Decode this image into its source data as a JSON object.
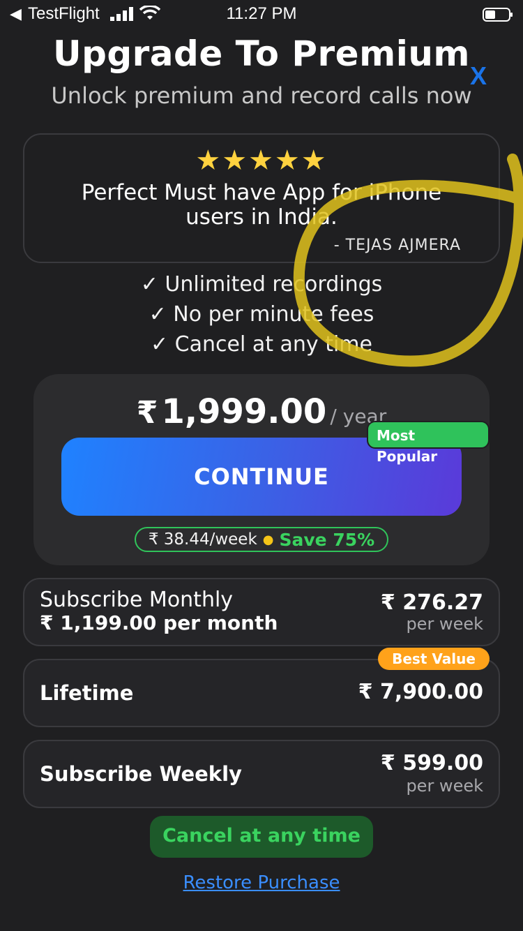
{
  "status_bar": {
    "back_arrow": "◀",
    "carrier": "TestFlight",
    "time": "11:27 PM",
    "icons": [
      "signal-bars-icon",
      "wifi-icon",
      "battery-icon"
    ]
  },
  "header": {
    "title": "Upgrade To Premium",
    "close_label": "X",
    "subtitle": "Unlock premium and record calls now"
  },
  "review": {
    "stars": "★★★★★",
    "rating": 5,
    "text": "Perfect Must have App for iPhone users in India.",
    "author": "- TEJAS AJMERA"
  },
  "features": [
    "✓ Unlimited recordings",
    "✓ No per minute fees",
    "✓ Cancel at any time"
  ],
  "yearly_plan": {
    "currency": "₹",
    "price": "1,999.00",
    "period": "/ year",
    "badge": "Most Popular",
    "continue_label": "CONTINUE",
    "weekly_equivalent": "₹ 38.44/week",
    "save_text": "Save 75%"
  },
  "plans": {
    "monthly": {
      "title": "Subscribe Monthly",
      "subtitle": "₹ 1,199.00 per month",
      "price": "₹  276.27",
      "per": "per week"
    },
    "lifetime": {
      "title": "Lifetime",
      "price": "₹ 7,900.00",
      "badge": "Best Value"
    },
    "weekly": {
      "title": "Subscribe Weekly",
      "price": "₹ 599.00",
      "per": "per week"
    }
  },
  "footer": {
    "cancel_label": "Cancel at any time",
    "restore_label": "Restore Purchase"
  },
  "colors": {
    "background": "#1f1f21",
    "accent_blue": "#1f82ff",
    "accent_green": "#2fc25b",
    "accent_orange": "#ffa21a",
    "star_yellow": "#ffd23f",
    "annotation_yellow": "#e0c21c"
  }
}
